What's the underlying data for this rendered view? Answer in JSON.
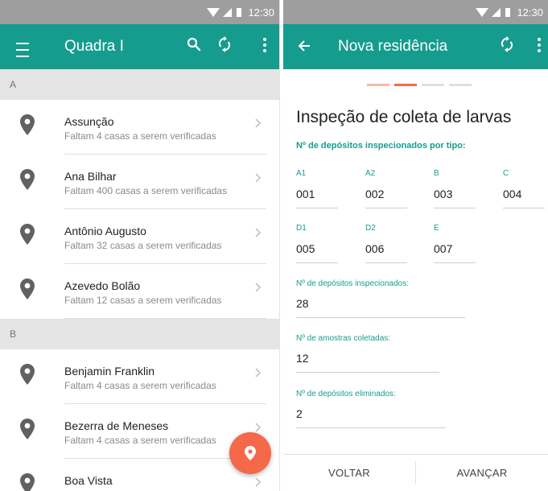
{
  "status_bar": {
    "time": "12:30"
  },
  "left_screen": {
    "app_bar": {
      "title": "Quadra I"
    },
    "sections": [
      {
        "letter": "A",
        "items": [
          {
            "name": "Assunção",
            "detail": "Faltam 4 casas a serem verificadas"
          },
          {
            "name": "Ana Bilhar",
            "detail": "Faltam 400 casas a serem verificadas"
          },
          {
            "name": "Antônio Augusto",
            "detail": "Faltam 32 casas a serem verificadas"
          },
          {
            "name": "Azevedo Bolão",
            "detail": "Faltam 12 casas a serem verificadas"
          }
        ]
      },
      {
        "letter": "B",
        "items": [
          {
            "name": "Benjamin Franklin",
            "detail": "Faltam 4 casas a serem verificadas"
          },
          {
            "name": "Bezerra de Meneses",
            "detail": "Faltam 4 casas a serem verificadas"
          },
          {
            "name": "Boa Vista",
            "detail": ""
          }
        ]
      }
    ]
  },
  "right_screen": {
    "app_bar": {
      "title": "Nova residência"
    },
    "stepper": {
      "total_steps": 4,
      "current_step": 2
    },
    "form": {
      "title": "Inspeção de coleta de larvas",
      "subtitle": "Nº de depósitos inspecionados por tipo:",
      "deposit_types": [
        {
          "label": "A1",
          "value": "001"
        },
        {
          "label": "A2",
          "value": "002"
        },
        {
          "label": "B",
          "value": "003"
        },
        {
          "label": "C",
          "value": "004"
        },
        {
          "label": "D1",
          "value": "005"
        },
        {
          "label": "D2",
          "value": "006"
        },
        {
          "label": "E",
          "value": "007"
        }
      ],
      "totals": [
        {
          "label": "Nº de depósitos inspecionados:",
          "value": "28"
        },
        {
          "label": "Nº de amostras coletadas:",
          "value": "12"
        },
        {
          "label": "Nº de depósitos eliminados:",
          "value": "2"
        }
      ]
    },
    "buttons": {
      "back": "VOLTAR",
      "next": "AVANÇAR"
    }
  },
  "colors": {
    "primary": "#159c8e",
    "accent": "#f4694a",
    "status_bar": "#9e9e9e",
    "section_header": "#e4e4e4"
  }
}
